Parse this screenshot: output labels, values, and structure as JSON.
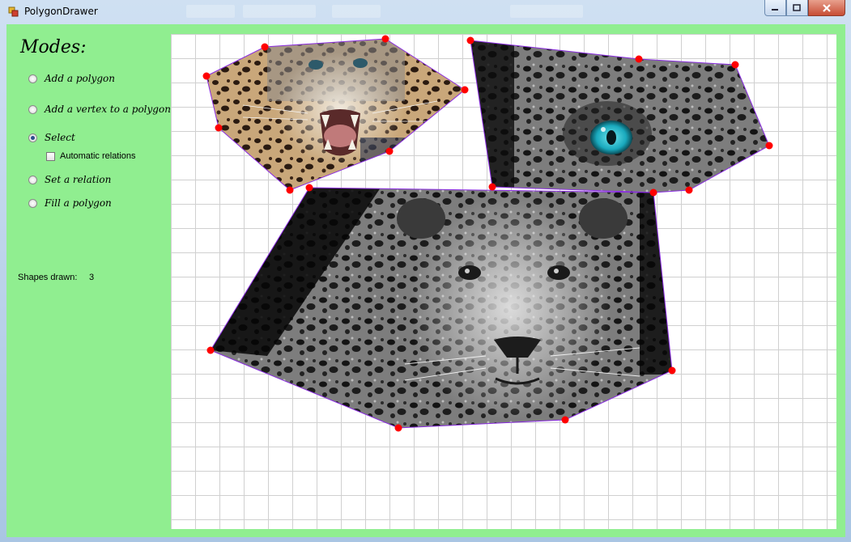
{
  "window": {
    "title": "PolygonDrawer"
  },
  "modes": {
    "title": "Modes:",
    "options": [
      {
        "label": "Add a polygon",
        "checked": false
      },
      {
        "label": "Add a vertex to a polygon",
        "checked": false
      },
      {
        "label": "Select",
        "checked": true
      },
      {
        "label": "Set a relation",
        "checked": false
      },
      {
        "label": "Fill a polygon",
        "checked": false
      }
    ],
    "automatic_relations": {
      "label": "Automatic relations",
      "checked": false
    }
  },
  "status": {
    "shapes_label": "Shapes drawn:",
    "shapes_count": "3"
  },
  "colors": {
    "panel_bg": "#90ee90",
    "vertex": "#ff0000",
    "edge": "#8a2be2",
    "canvas_grid": "#d0d0d0"
  },
  "canvas": {
    "polygons": [
      {
        "name": "roaring-leopard-polygon",
        "fill": "leopard-color-image"
      },
      {
        "name": "leopard-eye-polygon",
        "fill": "leopard-blue-eye-image"
      },
      {
        "name": "jaguar-face-polygon",
        "fill": "jaguar-bw-image"
      }
    ]
  }
}
